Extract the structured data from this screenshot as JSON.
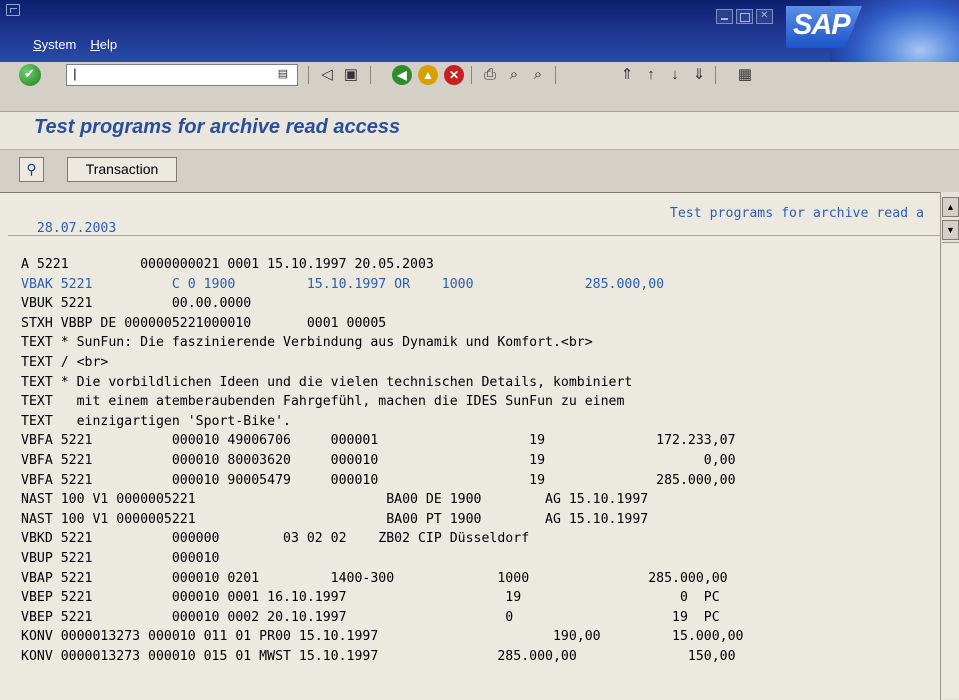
{
  "menu": {
    "system_accel": "S",
    "system_rest": "ystem",
    "help_accel": "H",
    "help_rest": "elp"
  },
  "logo_text": "SAP",
  "command_field": {
    "value": "|"
  },
  "icons": {
    "ok": "ok-check-icon",
    "dropdown": "history-dropdown-icon",
    "back": "back-arrow-icon",
    "save": "save-disk-icon",
    "nav_back": "green-back-icon",
    "exit": "yellow-exit-icon",
    "cancel": "red-cancel-icon",
    "print": "print-icon",
    "find": "find-binoculars-icon",
    "find_next": "find-next-icon",
    "first_page": "first-page-icon",
    "prev_page": "previous-page-icon",
    "next_page": "next-page-icon",
    "last_page": "last-page-icon",
    "layout": "layout-icon"
  },
  "title": "Test programs for archive read access",
  "app_toolbar": {
    "transaction_label": "Transaction"
  },
  "list": {
    "date": "28.07.2003",
    "header_title": "Test programs for archive read a",
    "rows": [
      {
        "text": "A 5221         0000000021 0001 15.10.1997 20.05.2003",
        "hl": false
      },
      {
        "text": "VBAK 5221          C 0 1900         15.10.1997 OR    1000              285.000,00",
        "hl": true
      },
      {
        "text": "VBUK 5221          00.00.0000",
        "hl": false
      },
      {
        "text": "STXH VBBP DE 0000005221000010       0001 00005",
        "hl": false
      },
      {
        "text": "TEXT * SunFun: Die faszinierende Verbindung aus Dynamik und Komfort.<br>",
        "hl": false
      },
      {
        "text": "TEXT / <br>",
        "hl": false
      },
      {
        "text": "TEXT * Die vorbildlichen Ideen und die vielen technischen Details, kombiniert",
        "hl": false
      },
      {
        "text": "TEXT   mit einem atemberaubenden Fahrgefühl, machen die IDES SunFun zu einem",
        "hl": false
      },
      {
        "text": "TEXT   einzigartigen 'Sport-Bike'.",
        "hl": false
      },
      {
        "text": "VBFA 5221          000010 49006706     000001                   19              172.233,07",
        "hl": false
      },
      {
        "text": "VBFA 5221          000010 80003620     000010                   19                    0,00",
        "hl": false
      },
      {
        "text": "VBFA 5221          000010 90005479     000010                   19              285.000,00",
        "hl": false
      },
      {
        "text": "NAST 100 V1 0000005221                        BA00 DE 1900        AG 15.10.1997",
        "hl": false
      },
      {
        "text": "NAST 100 V1 0000005221                        BA00 PT 1900        AG 15.10.1997",
        "hl": false
      },
      {
        "text": "VBKD 5221          000000        03 02 02    ZB02 CIP Düsseldorf",
        "hl": false
      },
      {
        "text": "VBUP 5221          000010",
        "hl": false
      },
      {
        "text": "VBAP 5221          000010 0201         1400-300             1000               285.000,00",
        "hl": false
      },
      {
        "text": "VBEP 5221          000010 0001 16.10.1997                    19                    0  PC",
        "hl": false
      },
      {
        "text": "VBEP 5221          000010 0002 20.10.1997                    0                    19  PC",
        "hl": false
      },
      {
        "text": "KONV 0000013273 000010 011 01 PR00 15.10.1997                      190,00         15.000,00",
        "hl": false
      },
      {
        "text": "KONV 0000013273 000010 015 01 MWST 15.10.1997               285.000,00              150,00",
        "hl": false
      }
    ]
  }
}
